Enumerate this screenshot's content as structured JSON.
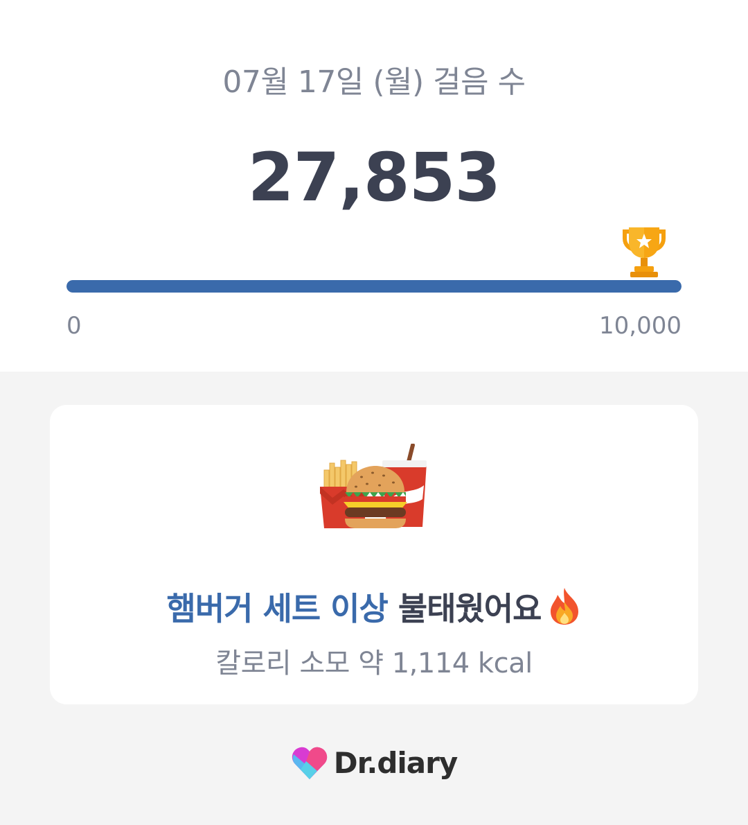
{
  "header": {
    "date_title": "07월 17일 (월) 걸음 수",
    "step_count": "27,853"
  },
  "progress": {
    "min_label": "0",
    "max_label": "10,000",
    "fraction": 1.0,
    "fill_color": "#3a6aab",
    "goal_icon": "trophy-icon"
  },
  "calorie_card": {
    "food_icon": "burger-set-icon",
    "headline_accent": "햄버거 세트 이상",
    "headline_rest": " 불태웠어요",
    "headline_icon": "fire-icon",
    "kcal_text": "칼로리 소모 약 1,114 kcal"
  },
  "footer": {
    "brand_name": "Dr.diary",
    "brand_icon": "drdiary-logo"
  },
  "colors": {
    "accent": "#3a6aab",
    "text_dark": "#3c4152",
    "text_muted": "#7f8594",
    "background": "#f4f4f4"
  }
}
